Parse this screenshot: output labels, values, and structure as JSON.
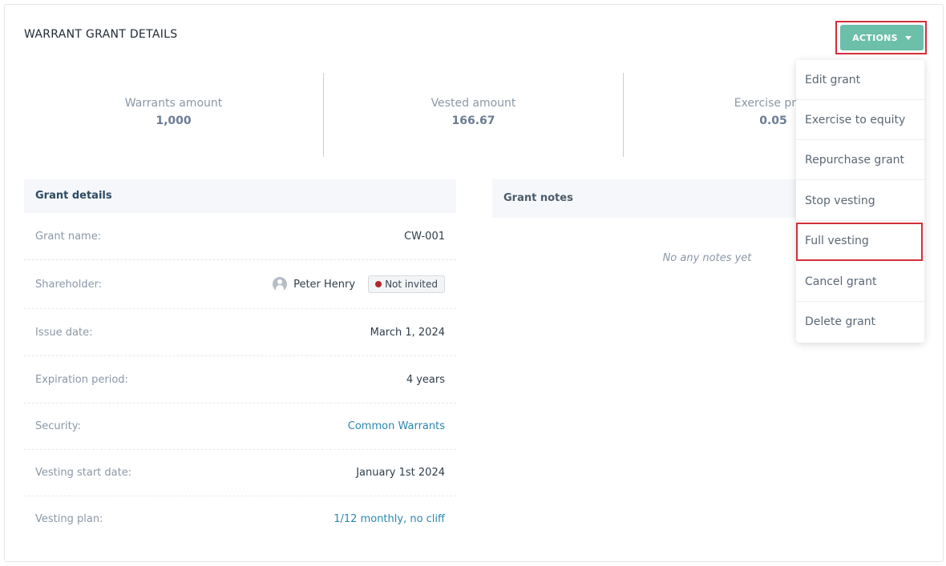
{
  "header": {
    "title": "WARRANT GRANT DETAILS",
    "actions_label": "ACTIONS"
  },
  "stats": [
    {
      "label": "Warrants amount",
      "value": "1,000"
    },
    {
      "label": "Vested amount",
      "value": "166.67"
    },
    {
      "label": "Exercise price",
      "value": "0.05"
    }
  ],
  "grant_details": {
    "title": "Grant details",
    "rows": [
      {
        "label": "Grant name:",
        "value": "CW-001"
      },
      {
        "label": "Shareholder:",
        "value": "Peter Henry",
        "badge": "Not invited"
      },
      {
        "label": "Issue date:",
        "value": "March 1, 2024"
      },
      {
        "label": "Expiration period:",
        "value": "4 years"
      },
      {
        "label": "Security:",
        "value": "Common Warrants"
      },
      {
        "label": "Vesting start date:",
        "value": "January 1st 2024"
      },
      {
        "label": "Vesting plan:",
        "value": "1/12 monthly, no cliff"
      }
    ]
  },
  "grant_notes": {
    "title": "Grant notes",
    "empty_text": "No any notes yet"
  },
  "actions_menu": {
    "items": [
      "Edit grant",
      "Exercise to equity",
      "Repurchase grant",
      "Stop vesting",
      "Full vesting",
      "Cancel grant",
      "Delete grant"
    ],
    "highlighted": "Full vesting"
  },
  "colors": {
    "accent": "#6cbfa9",
    "link": "#2a86b0",
    "highlight_border": "#d32f3a",
    "status_dot": "#b5262d"
  },
  "icons": {
    "actions_caret": "caret-down-icon",
    "avatar": "user-avatar-icon",
    "status": "status-dot-icon"
  }
}
